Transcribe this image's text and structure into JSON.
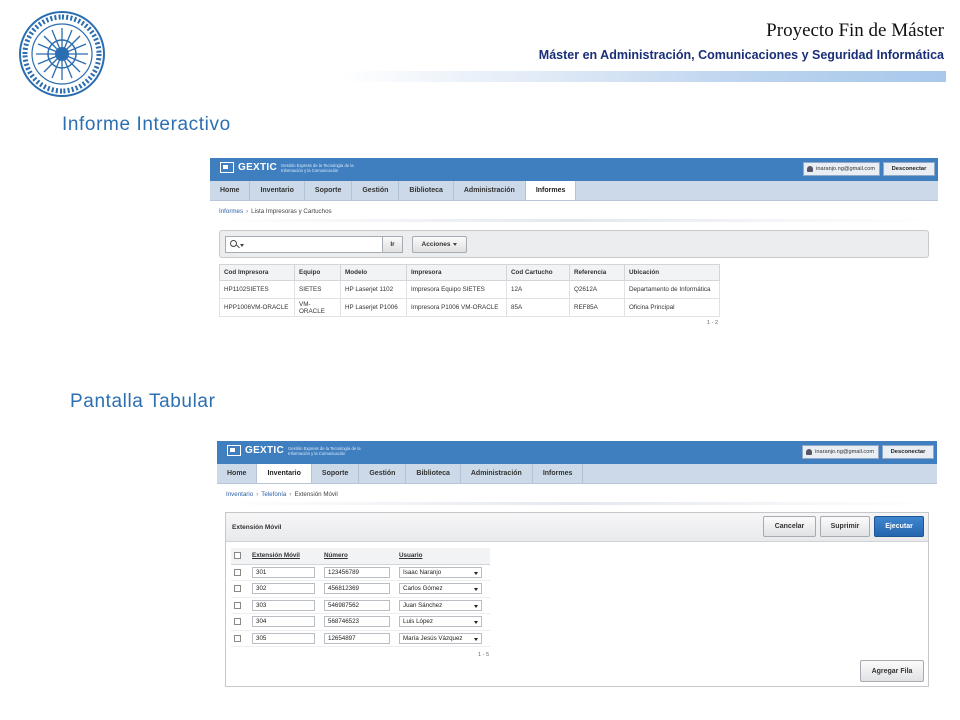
{
  "slide": {
    "title": "Proyecto Fin de Máster",
    "subtitle": "Máster en Administración, Comunicaciones y Seguridad Informática"
  },
  "sections": {
    "interactive": "Informe Interactivo",
    "tabular": "Pantalla Tabular"
  },
  "app": {
    "logo": "GEXTIC",
    "logo_sub": "Gestión Express de la Tecnología de la Información y la Comunicación",
    "user": "inaranjo.ng@gmail.com",
    "logout": "Desconectar",
    "tabs": [
      "Home",
      "Inventario",
      "Soporte",
      "Gestión",
      "Biblioteca",
      "Administración",
      "Informes"
    ]
  },
  "report": {
    "breadcrumb": [
      "Informes",
      "Lista Impresoras y Cartuchos"
    ],
    "go_label": "Ir",
    "actions_label": "Acciones",
    "columns": [
      "Cod Impresora",
      "Equipo",
      "Modelo",
      "Impresora",
      "Cod Cartucho",
      "Referencia",
      "Ubicación"
    ],
    "rows": [
      [
        "HP1102SIETES",
        "SIETES",
        "HP Laserjet 1102",
        "Impresora Equipo SIETES",
        "12A",
        "Q2612A",
        "Departamento de Informática"
      ],
      [
        "HPP1006VM-ORACLE",
        "VM-ORACLE",
        "HP Laserjet P1006",
        "Impresora P1006 VM-ORACLE",
        "85A",
        "REF85A",
        "Oficina Principal"
      ]
    ],
    "pagination": "1 - 2"
  },
  "tabular": {
    "breadcrumb": [
      "Inventario",
      "Telefonía",
      "Extensión Móvil"
    ],
    "region_title": "Extensión Móvil",
    "cancel_label": "Cancelar",
    "delete_label": "Suprimir",
    "run_label": "Ejecutar",
    "columns": [
      "Extensión Móvil",
      "Número",
      "Usuario"
    ],
    "rows": [
      {
        "ext": "301",
        "num": "123456789",
        "user": "Isaac Naranjo"
      },
      {
        "ext": "302",
        "num": "456812369",
        "user": "Carlos Gómez"
      },
      {
        "ext": "303",
        "num": "546987562",
        "user": "Juan Sánchez"
      },
      {
        "ext": "304",
        "num": "568746523",
        "user": "Luis López"
      },
      {
        "ext": "305",
        "num": "12654897",
        "user": "María Jesús Vázquez"
      }
    ],
    "pagination": "1 - 5",
    "add_row_label": "Agregar Fila"
  },
  "colors": {
    "app_header": "#3f7fc0",
    "nav_bar": "#ccd9e8",
    "heading": "#2c6fb3",
    "primary_button": "#2466ae"
  }
}
